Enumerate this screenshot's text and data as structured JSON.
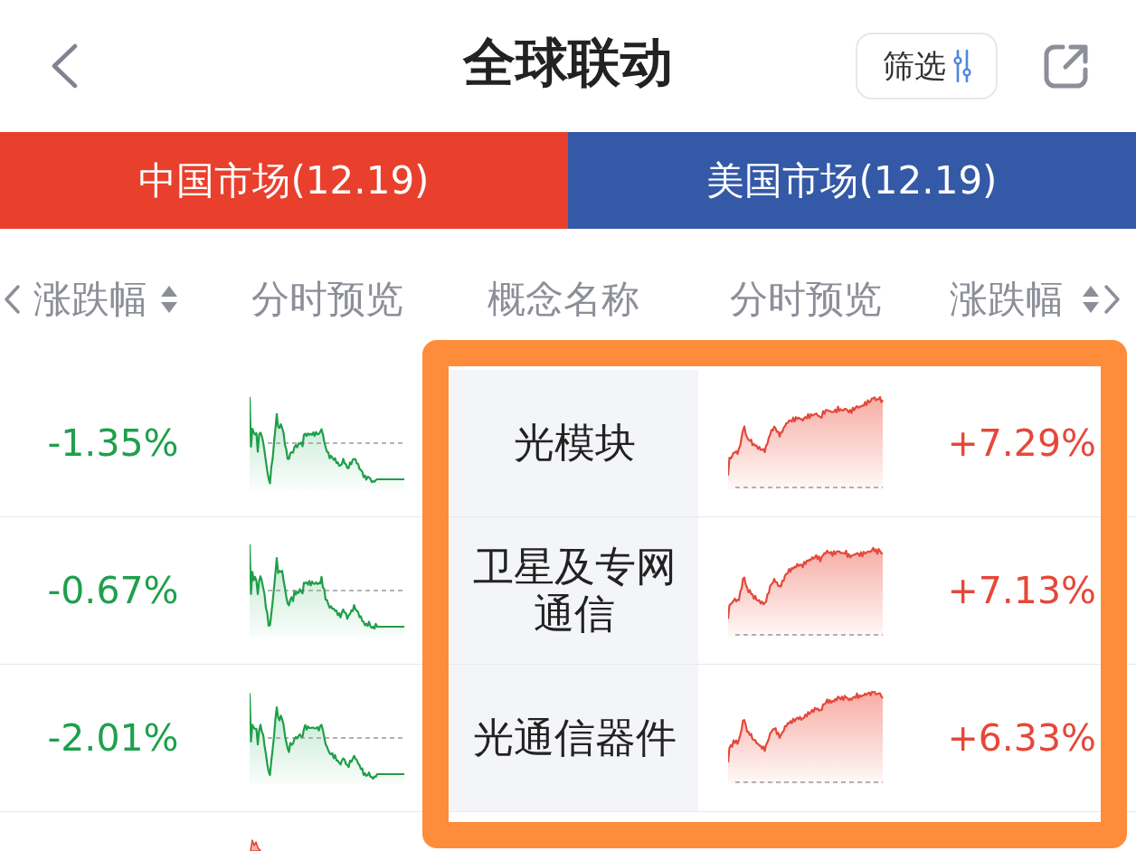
{
  "header": {
    "title": "全球联动",
    "filter_button": "筛选"
  },
  "markets": [
    {
      "label": "中国市场(12.19)",
      "color": "#e8402d"
    },
    {
      "label": "美国市场(12.19)",
      "color": "#3459a6"
    }
  ],
  "columns": [
    {
      "label": "涨跌幅",
      "kind": "sort-left"
    },
    {
      "label": "分时预览",
      "kind": "plain"
    },
    {
      "label": "概念名称",
      "kind": "plain"
    },
    {
      "label": "分时预览",
      "kind": "plain"
    },
    {
      "label": "涨跌幅",
      "kind": "sort-right"
    }
  ],
  "rows": [
    {
      "cn_change": "-1.35%",
      "cn_rising": false,
      "name": "光模块",
      "us_rising": true,
      "us_change": "+7.29%"
    },
    {
      "cn_change": "-0.67%",
      "cn_rising": false,
      "name": "卫星及专网通信",
      "us_rising": true,
      "us_change": "+7.13%"
    },
    {
      "cn_change": "-2.01%",
      "cn_rising": false,
      "name": "光通信器件",
      "us_rising": true,
      "us_change": "+6.33%"
    }
  ],
  "partial_row": {
    "cn_rising": true
  }
}
